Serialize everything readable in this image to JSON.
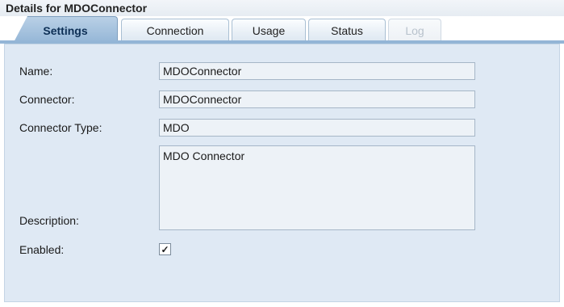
{
  "header": {
    "title": "Details for MDOConnector"
  },
  "tabs": [
    {
      "label": "Settings",
      "active": true
    },
    {
      "label": "Connection"
    },
    {
      "label": "Usage"
    },
    {
      "label": "Status"
    },
    {
      "label": "Log",
      "disabled": true
    }
  ],
  "form": {
    "name_label": "Name:",
    "name_value": "MDOConnector",
    "connector_label": "Connector:",
    "connector_value": "MDOConnector",
    "type_label": "Connector Type:",
    "type_value": "MDO",
    "description_label": "Description:",
    "description_value": "MDO Connector",
    "enabled_label": "Enabled:",
    "enabled_checked": true,
    "check_glyph": "✓"
  },
  "colors": {
    "panel_bg": "#dfe9f4",
    "active_tab": "#93b5d6",
    "field_bg": "#edf2f7"
  }
}
